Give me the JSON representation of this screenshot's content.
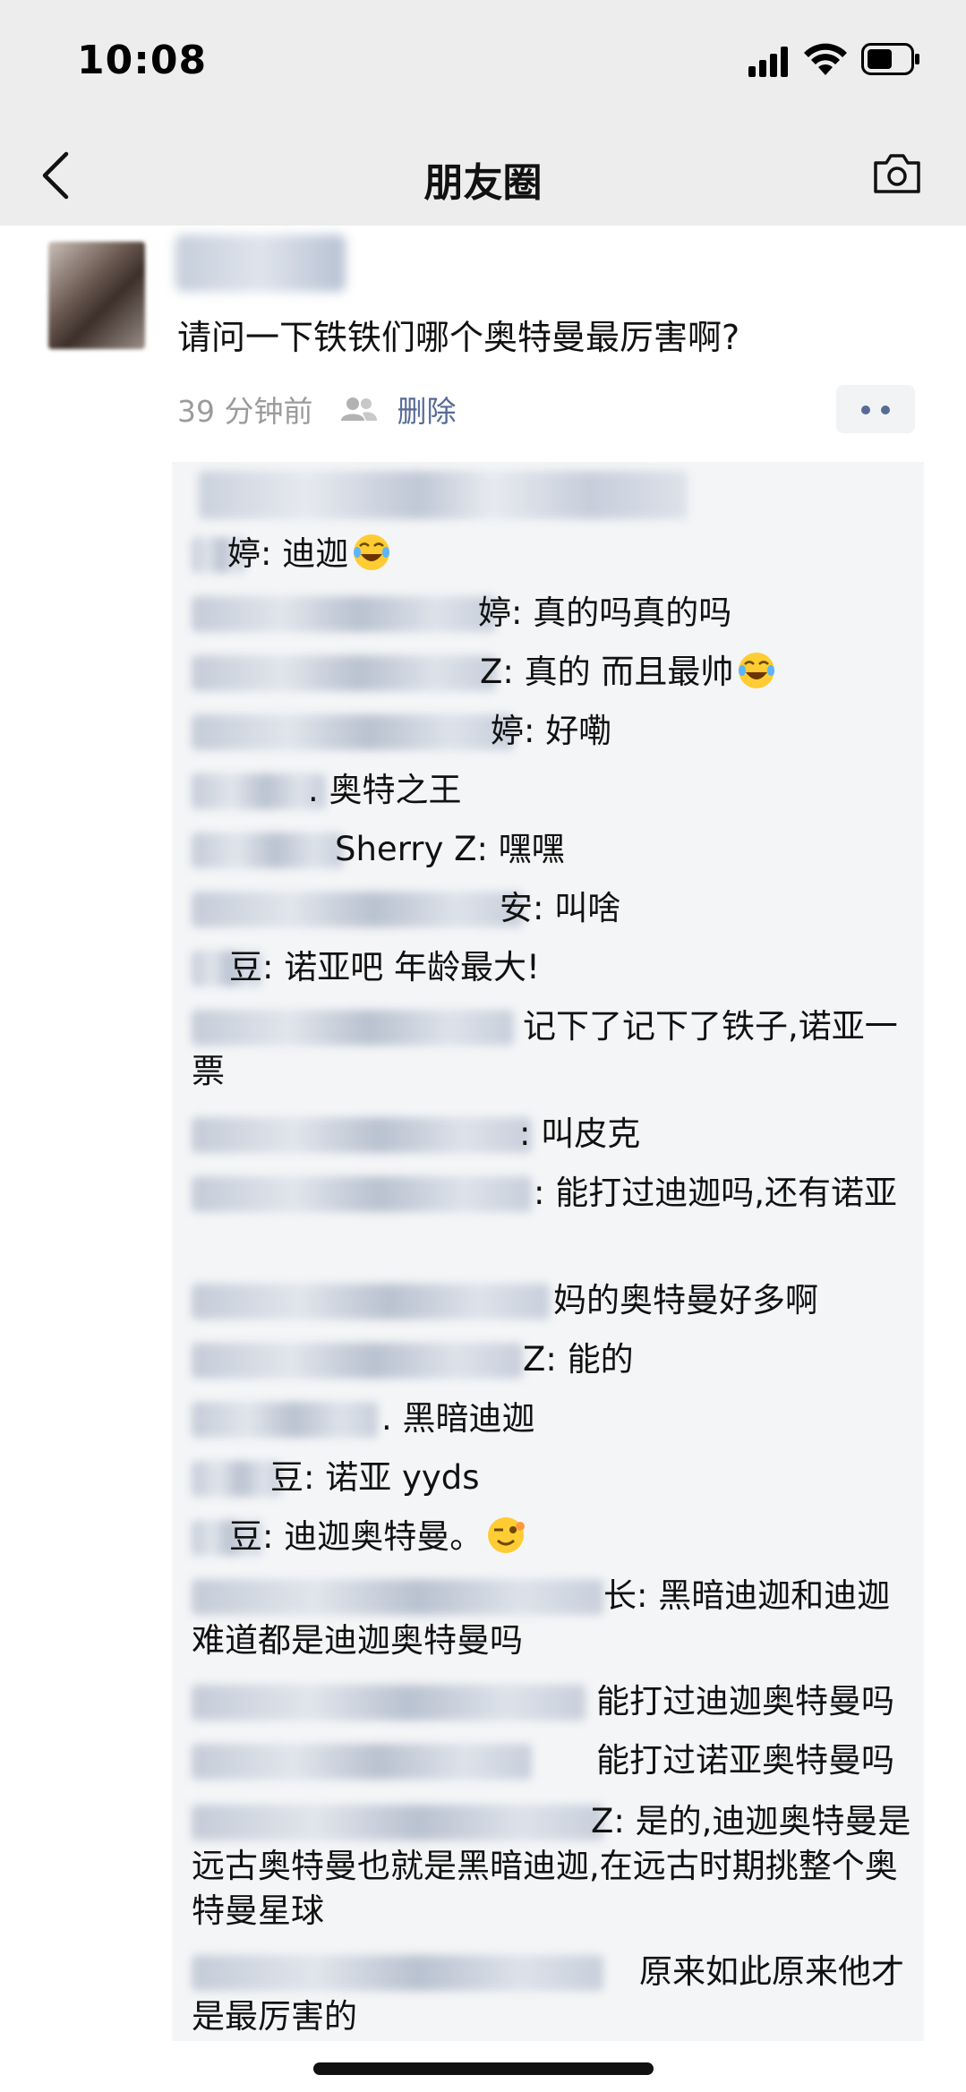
{
  "status_bar": {
    "time": "10:08",
    "signal_icon": "signal-icon",
    "wifi_icon": "wifi-icon",
    "battery_icon": "battery-icon"
  },
  "nav": {
    "title": "朋友圈",
    "back_icon": "chevron-left-icon",
    "camera_icon": "camera-icon"
  },
  "post": {
    "text": "请问一下铁铁们哪个奥特曼最厉害啊?",
    "time": "39 分钟前",
    "visibility_icon": "people-icon",
    "delete_label": "删除",
    "more_icon": "more-dots-icon"
  },
  "comments": [
    "婷: 迪迦",
    "婷: 真的吗真的吗",
    "Z: 真的 而且最帅",
    "婷: 好嘞",
    ". 奥特之王",
    "Sherry Z: 嘿嘿",
    "安: 叫啥",
    "豆: 诺亚吧 年龄最大!",
    "记下了记下了铁子,诺亚一票",
    ": 叫皮克",
    ": 能打过迪迦吗,还有诺亚",
    "妈的奥特曼好多啊",
    "Z: 能的",
    ". 黑暗迪迦",
    "豆: 诺亚 yyds",
    "豆: 迪迦奥特曼。",
    "长: 黑暗迪迦和迪迦难道都是迪迦奥特曼吗",
    "能打过迪迦奥特曼吗",
    "能打过诺亚奥特曼吗",
    "Z: 是的,迪迦奥特曼是远古奥特曼也就是黑暗迪迦,在远古时期挑整个奥特曼星球",
    "原来如此原来他才是最厉害的"
  ],
  "emoji_icons": {
    "laugh_tears": "laughing-tears-emoji",
    "wink": "winking-emoji"
  },
  "colors": {
    "nav_bg": "#ededed",
    "link_blue": "#576b95",
    "comment_bg": "#f4f5f7"
  }
}
